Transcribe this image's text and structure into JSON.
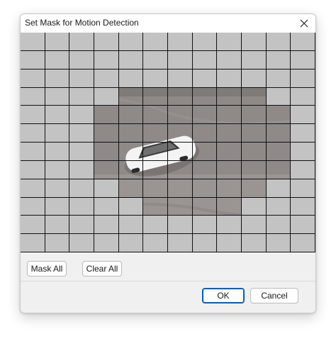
{
  "dialog": {
    "title": "Set Mask for Motion Detection",
    "close_icon": "close-icon"
  },
  "mask_grid": {
    "rows": 12,
    "cols": 12,
    "cells": [
      "111111111111",
      "111111111111",
      "111111111111",
      "111100000011",
      "111000000001",
      "111000000001",
      "111000000001",
      "111000000001",
      "111100000011",
      "111110000111",
      "111111111111",
      "111111111111"
    ]
  },
  "buttons": {
    "mask_all": "Mask All",
    "clear_all": "Clear All",
    "ok": "OK",
    "cancel": "Cancel"
  },
  "colors": {
    "masked_cell": "#c3c3c3",
    "grid_line": "#111111",
    "primary_border": "#005fb8"
  }
}
